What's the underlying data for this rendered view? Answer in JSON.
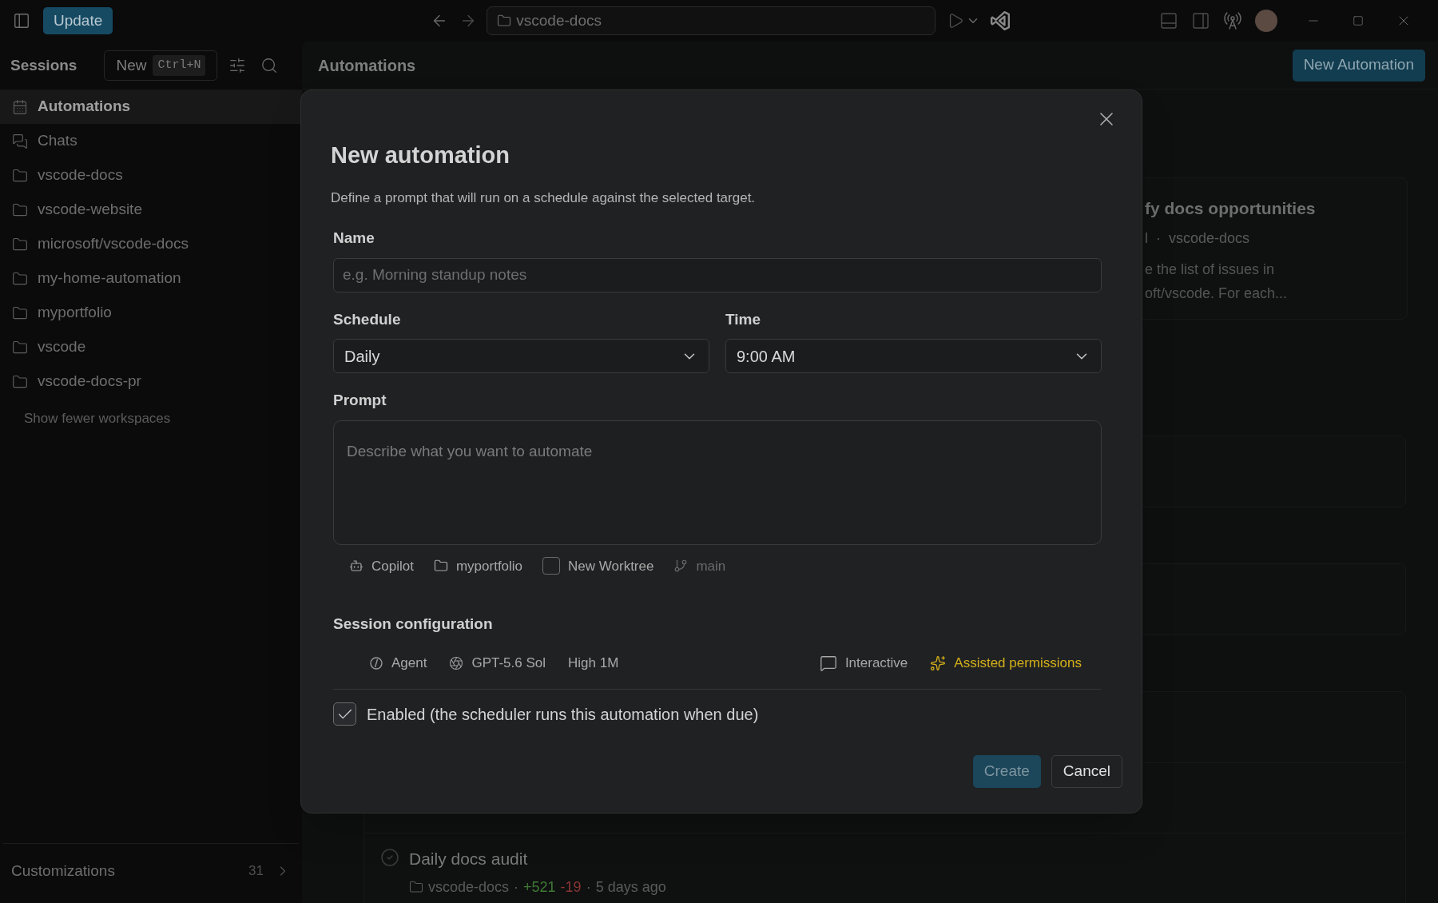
{
  "title_bar": {
    "update_button": "Update",
    "command_center": "vscode-docs"
  },
  "sidebar": {
    "title": "Sessions",
    "new_button": {
      "label": "New",
      "shortcut": "Ctrl+N"
    },
    "items": [
      {
        "kind": "automations",
        "label": "Automations",
        "selected": true
      },
      {
        "kind": "chats",
        "label": "Chats",
        "selected": false
      },
      {
        "kind": "folder",
        "label": "vscode-docs",
        "selected": false
      },
      {
        "kind": "folder",
        "label": "vscode-website",
        "selected": false
      },
      {
        "kind": "folder",
        "label": "microsoft/vscode-docs",
        "selected": false
      },
      {
        "kind": "folder",
        "label": "my-home-automation",
        "selected": false
      },
      {
        "kind": "folder",
        "label": "myportfolio",
        "selected": false
      },
      {
        "kind": "folder",
        "label": "vscode",
        "selected": false
      },
      {
        "kind": "folder",
        "label": "vscode-docs-pr",
        "selected": false
      }
    ],
    "toggle_link": "Show fewer workspaces",
    "footer": {
      "label": "Customizations",
      "count": "31"
    }
  },
  "main": {
    "title": "Automations",
    "new_button": "New Automation",
    "card": {
      "title": "fy docs opportunities",
      "meta_left": "l",
      "separator": "·",
      "meta_repo": "vscode-docs",
      "description_lines": [
        "e the list of issues in",
        "oft/vscode. For each..."
      ]
    },
    "runs": [
      {
        "title": "Daily docs audit",
        "repo": "vscode-docs",
        "separator": "·",
        "added": "+521",
        "removed": "-19",
        "time": "5 days ago"
      }
    ]
  },
  "dialog": {
    "title": "New automation",
    "description": "Define a prompt that will run on a schedule against the selected target.",
    "name": {
      "label": "Name",
      "placeholder": "e.g. Morning standup notes"
    },
    "schedule": {
      "label": "Schedule",
      "value": "Daily"
    },
    "time": {
      "label": "Time",
      "value": "9:00 AM"
    },
    "prompt": {
      "label": "Prompt",
      "placeholder": "Describe what you want to automate"
    },
    "options": [
      {
        "kind": "copilot",
        "label": "Copilot"
      },
      {
        "kind": "folder",
        "label": "myportfolio"
      },
      {
        "kind": "checkbox",
        "label": "New Worktree",
        "checked": false
      },
      {
        "kind": "branch",
        "label": "main",
        "disabled": true
      }
    ],
    "session_config": {
      "title": "Session configuration",
      "left": [
        {
          "kind": "agent",
          "label": "Agent"
        },
        {
          "kind": "model",
          "label": "GPT-5.6 Sol"
        },
        {
          "kind": "text",
          "label": "High 1M"
        }
      ],
      "right": [
        {
          "kind": "interactive",
          "label": "Interactive",
          "highlighted": false
        },
        {
          "kind": "permissions",
          "label": "Assisted permissions",
          "highlighted": true
        }
      ]
    },
    "enabled": {
      "label": "Enabled (the scheduler runs this automation when due)",
      "checked": true
    },
    "buttons": [
      {
        "kind": "primary",
        "label": "Create",
        "disabled": true
      },
      {
        "kind": "secondary",
        "label": "Cancel",
        "disabled": false
      }
    ]
  }
}
